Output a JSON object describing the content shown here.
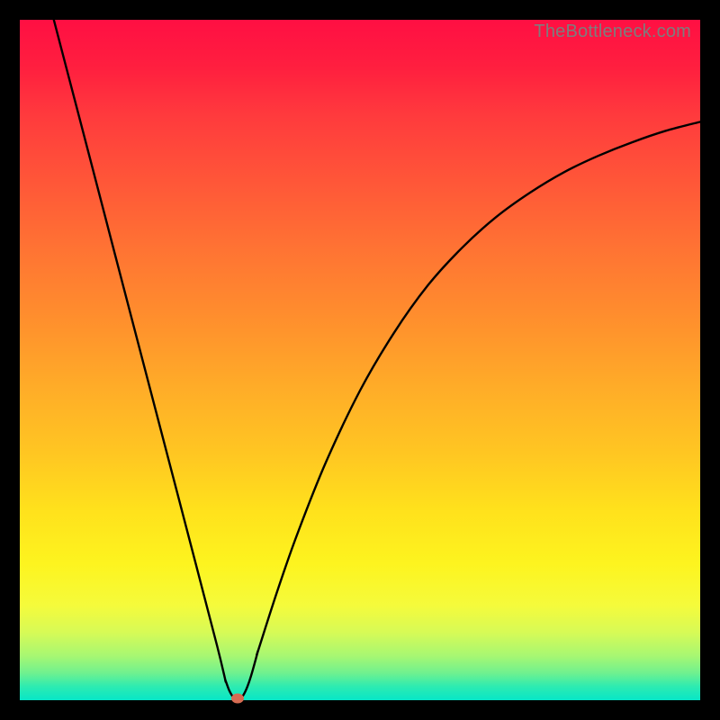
{
  "watermark": "TheBottleneck.com",
  "colors": {
    "background": "#000000",
    "gradient_top": "#ff0f43",
    "gradient_bottom": "#07e6c7",
    "curve": "#000000",
    "marker": "#d66b52"
  },
  "chart_data": {
    "type": "line",
    "title": "",
    "xlabel": "",
    "ylabel": "",
    "xlim": [
      0,
      100
    ],
    "ylim": [
      0,
      100
    ],
    "marker": {
      "x": 32,
      "y": 0
    },
    "series": [
      {
        "name": "left-branch",
        "x": [
          5,
          8,
          11,
          14,
          17,
          20,
          23,
          26,
          29,
          30.2
        ],
        "values": [
          100,
          88.5,
          77,
          65.5,
          54,
          42.5,
          31,
          19.5,
          8,
          3
        ]
      },
      {
        "name": "curve-near-min",
        "x": [
          30.2,
          30.8,
          31.4,
          32,
          32.6,
          33.2,
          34,
          35
        ],
        "values": [
          3,
          1.4,
          0.4,
          0,
          0.4,
          1.4,
          3.6,
          7.2
        ]
      },
      {
        "name": "right-branch",
        "x": [
          35,
          38,
          41,
          45,
          50,
          55,
          60,
          65,
          70,
          75,
          80,
          85,
          90,
          95,
          100
        ],
        "values": [
          7.2,
          16.5,
          25,
          35,
          45.5,
          54,
          61,
          66.5,
          71,
          74.6,
          77.6,
          80,
          82,
          83.7,
          85
        ]
      }
    ]
  }
}
